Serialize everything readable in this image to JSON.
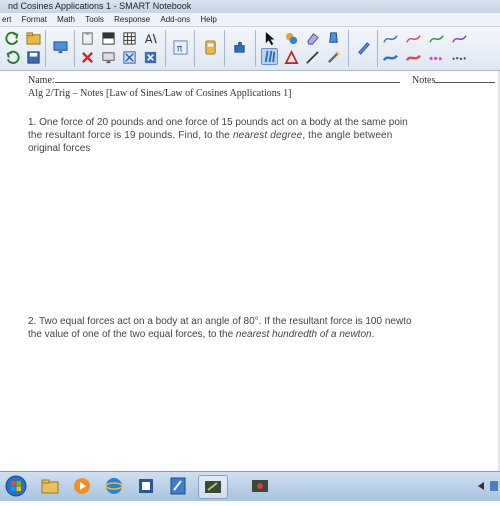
{
  "window": {
    "title": "nd Cosines Applications 1 - SMART Notebook"
  },
  "menu": [
    "ert",
    "Format",
    "Math",
    "Tools",
    "Response",
    "Add-ons",
    "Help"
  ],
  "icons": {
    "pen_color_1": "#3b6fb0",
    "pen_color_2": "#d94a4a",
    "pen_color_3": "#2f8a3f",
    "pen_color_4": "#7a3fb0",
    "highlight_color": "#e040c0",
    "toolbar_accent": "#1f6fc0"
  },
  "document": {
    "name_label": "Name:",
    "notes_label": "Notes",
    "header": "Alg 2/Trig – Notes [Law of Sines/Law of Cosines Applications 1]",
    "problem1": {
      "line1": "1.  One force of 20 pounds and one force of 15 pounds act on a body at the same poin",
      "line2_a": "the resultant force is 19 pounds.  Find, to the ",
      "line2_em": "nearest degree",
      "line2_b": ", the angle between",
      "line3": "original forces"
    },
    "problem2": {
      "line1": "2.  Two equal forces act on a body at an angle of 80°.  If the resultant force is 100 newto",
      "line2_a": "the value of one of the two equal forces, to the ",
      "line2_em": "nearest hundredth of a newton",
      "line2_b": "."
    }
  }
}
